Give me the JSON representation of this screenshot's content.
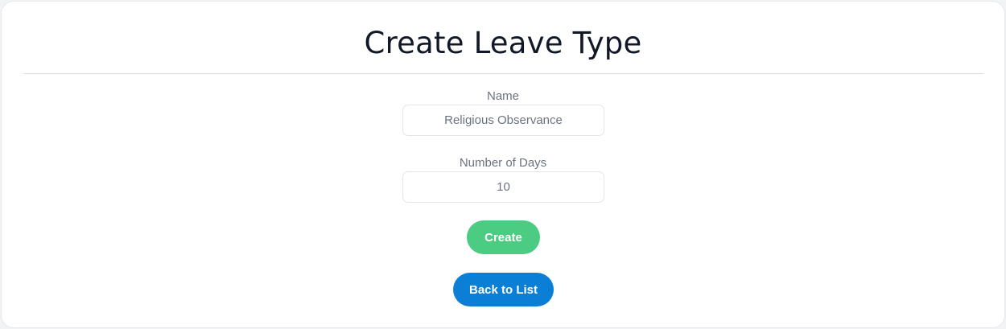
{
  "page": {
    "title": "Create Leave Type"
  },
  "form": {
    "name": {
      "label": "Name",
      "value": "Religious Observance"
    },
    "days": {
      "label": "Number of Days",
      "value": "10"
    },
    "create_label": "Create",
    "back_label": "Back to List"
  },
  "colors": {
    "create_button": "#4ccb83",
    "back_button": "#0b7fd6",
    "title_text": "#111827",
    "label_text": "#6b7280"
  }
}
